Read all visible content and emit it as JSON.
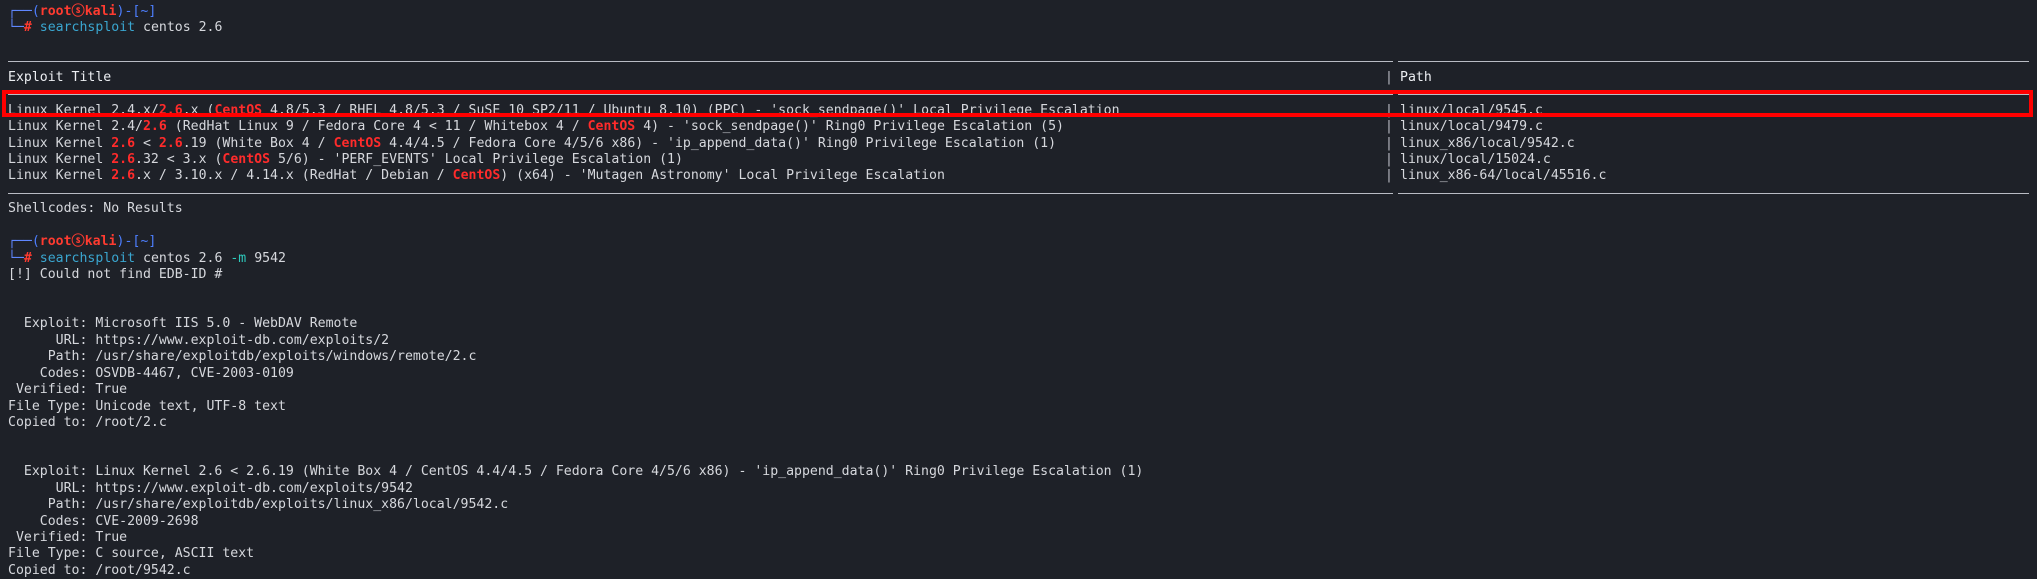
{
  "terminal": {
    "background": "#1e2128",
    "foreground": "#d6d8dd",
    "highlight_color": "#ff2b2b",
    "annotation_color": "#ff0000"
  },
  "prompt1": {
    "user": "root",
    "at": "ⓢ",
    "host": "kali",
    "path": "~",
    "hash": "#",
    "command": "searchsploit",
    "args": " centos 2.6"
  },
  "prompt2": {
    "user": "root",
    "at": "ⓢ",
    "host": "kali",
    "path": "~",
    "hash": "#",
    "command": "searchsploit",
    "args_pre": " centos 2.6 ",
    "flag": "-m",
    "args_post": " 9542"
  },
  "table": {
    "header": {
      "title": "Exploit Title",
      "path": "Path",
      "sep": "|"
    },
    "rows": [
      {
        "sep": "|",
        "path": "linux/local/9545.c",
        "parts": [
          {
            "t": "Linux Kernel 2.4.x/",
            "h": false
          },
          {
            "t": "2.6",
            "h": true
          },
          {
            "t": ".x (",
            "h": false
          },
          {
            "t": "CentOS",
            "h": true
          },
          {
            "t": " 4.8/5.3 / RHEL 4.8/5.3 / SuSE 10 SP2/11 / Ubuntu 8.10) (PPC) - 'sock_sendpage()' Local Privilege Escalation",
            "h": false
          }
        ]
      },
      {
        "sep": "|",
        "path": "linux/local/9479.c",
        "parts": [
          {
            "t": "Linux Kernel 2.4/",
            "h": false
          },
          {
            "t": "2.6",
            "h": true
          },
          {
            "t": " (RedHat Linux 9 / Fedora Core 4 < 11 / Whitebox 4 / ",
            "h": false
          },
          {
            "t": "CentOS",
            "h": true
          },
          {
            "t": " 4) - 'sock_sendpage()' Ring0 Privilege Escalation (5)",
            "h": false
          }
        ]
      },
      {
        "sep": "|",
        "path": "linux_x86/local/9542.c",
        "parts": [
          {
            "t": "Linux Kernel ",
            "h": false
          },
          {
            "t": "2.6",
            "h": true
          },
          {
            "t": " < ",
            "h": false
          },
          {
            "t": "2.6",
            "h": true
          },
          {
            "t": ".19 (White Box 4 / ",
            "h": false
          },
          {
            "t": "CentOS",
            "h": true
          },
          {
            "t": " 4.4/4.5 / Fedora Core 4/5/6 x86) - 'ip_append_data()' Ring0 Privilege Escalation (1)",
            "h": false
          }
        ]
      },
      {
        "sep": "|",
        "path": "linux/local/15024.c",
        "parts": [
          {
            "t": "Linux Kernel ",
            "h": false
          },
          {
            "t": "2.6",
            "h": true
          },
          {
            "t": ".32 < 3.x (",
            "h": false
          },
          {
            "t": "CentOS",
            "h": true
          },
          {
            "t": " 5/6) - 'PERF_EVENTS' Local Privilege Escalation (1)",
            "h": false
          }
        ]
      },
      {
        "sep": "|",
        "path": "linux_x86-64/local/45516.c",
        "parts": [
          {
            "t": "Linux Kernel ",
            "h": false
          },
          {
            "t": "2.6",
            "h": true
          },
          {
            "t": ".x / 3.10.x / 4.14.x (RedHat / Debian / ",
            "h": false
          },
          {
            "t": "CentOS",
            "h": true
          },
          {
            "t": ") (x64) - 'Mutagen Astronomy' Local Privilege Escalation",
            "h": false
          }
        ]
      }
    ]
  },
  "shellcodes_line": "Shellcodes: No Results",
  "error_line": "[!] Could not find EDB-ID #",
  "exploit_blocks": [
    {
      "exploit": "  Exploit: Microsoft IIS 5.0 - WebDAV Remote",
      "url": "      URL: https://www.exploit-db.com/exploits/2",
      "path": "     Path: /usr/share/exploitdb/exploits/windows/remote/2.c",
      "codes": "    Codes: OSVDB-4467, CVE-2003-0109",
      "verified": " Verified: True",
      "file_type": "File Type: Unicode text, UTF-8 text",
      "copied": "Copied to: /root/2.c"
    },
    {
      "exploit": "  Exploit: Linux Kernel 2.6 < 2.6.19 (White Box 4 / CentOS 4.4/4.5 / Fedora Core 4/5/6 x86) - 'ip_append_data()' Ring0 Privilege Escalation (1)",
      "url": "      URL: https://www.exploit-db.com/exploits/9542",
      "path": "     Path: /usr/share/exploitdb/exploits/linux_x86/local/9542.c",
      "codes": "    Codes: CVE-2009-2698",
      "verified": " Verified: True",
      "file_type": "File Type: C source, ASCII text",
      "copied": "Copied to: /root/9542.c"
    }
  ]
}
